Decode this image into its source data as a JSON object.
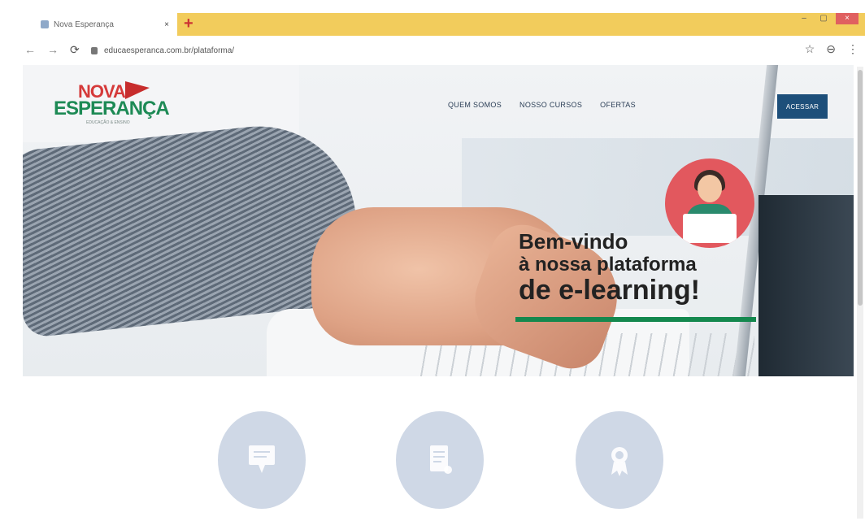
{
  "browser": {
    "tab_title": "Nova Esperança",
    "tab_close": "×",
    "new_tab": "+",
    "url": "educaesperanca.com.br/plataforma/",
    "window_controls": {
      "minimize": "–",
      "maximize": "▢",
      "close": "×"
    },
    "icons": {
      "back": "←",
      "forward": "→",
      "reload": "⟳",
      "star": "☆",
      "profile": "⊖",
      "menu": "⋮"
    }
  },
  "site": {
    "logo": {
      "line1": "NOVA",
      "line2": "ESPERANÇA",
      "tagline": "EDUCAÇÃO & ENSINO"
    },
    "menu": [
      "QUEM SOMOS",
      "NOSSO CURSOS",
      "OFERTAS"
    ],
    "cta_label": "ACESSAR",
    "hero": {
      "line1": "Bem-vindo",
      "line2": "à nossa plataforma",
      "line3": "de e-learning!"
    },
    "features": [
      {
        "icon": "certificate-icon"
      },
      {
        "icon": "document-icon"
      },
      {
        "icon": "award-icon"
      }
    ]
  },
  "colors": {
    "tabstrip": "#f2cc5c",
    "brand_red": "#d53a3a",
    "brand_green": "#1d8a55",
    "cta_blue": "#1d4f7a",
    "feature_circle": "#cfd8e6"
  }
}
